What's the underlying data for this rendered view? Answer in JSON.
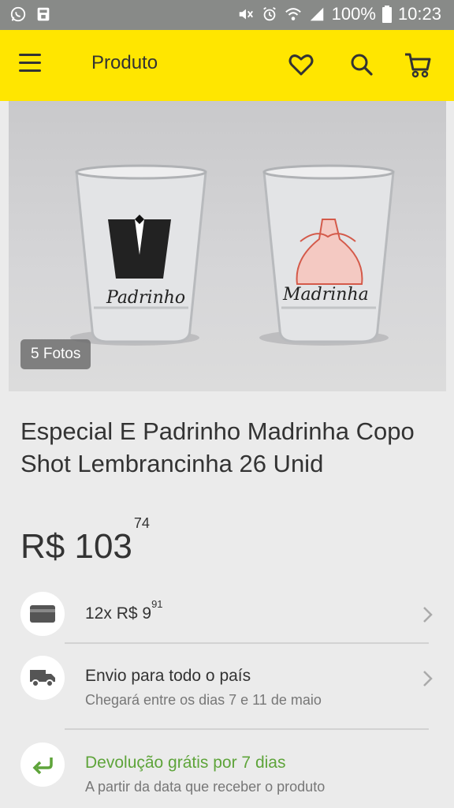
{
  "status_bar": {
    "battery": "100%",
    "time": "10:23"
  },
  "header": {
    "title": "Produto",
    "icons": [
      "menu-icon",
      "heart-icon",
      "search-icon",
      "cart-icon"
    ],
    "color": "#ffe600"
  },
  "gallery": {
    "photo_count": "5 Fotos",
    "glasses": [
      {
        "label": "Padrinho",
        "graphic": "tuxedo"
      },
      {
        "label": "Madrinha",
        "graphic": "dress"
      }
    ]
  },
  "product": {
    "title": "Especial E Padrinho Madrinha Copo Shot Lembrancinha 26 Unid",
    "price_currency": "R$",
    "price_integer": "103",
    "price_cents": "74"
  },
  "installments": {
    "icon": "credit-card-icon",
    "label": "12x R$ 9",
    "cents": "91"
  },
  "shipping": {
    "icon": "truck-icon",
    "title": "Envio para todo o país",
    "subtitle": "Chegará entre os dias 7 e 11 de maio"
  },
  "returns": {
    "icon": "return-arrow-icon",
    "title": "Devolução grátis por 7 dias",
    "subtitle": "A partir da data que receber o produto",
    "accent": "#5ea43a"
  }
}
